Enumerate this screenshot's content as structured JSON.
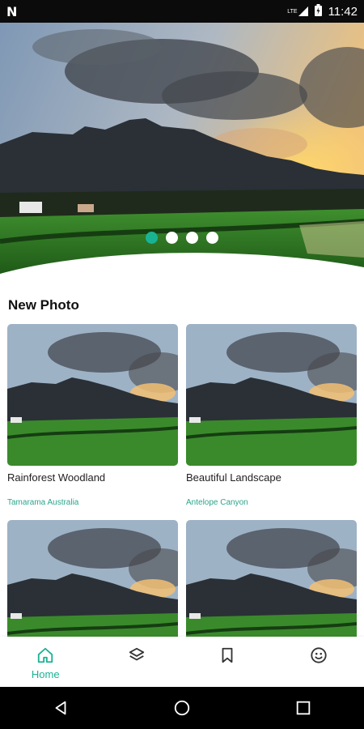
{
  "status": {
    "time": "11:42",
    "signal": "LTE"
  },
  "hero": {
    "slide_count": 4,
    "active_index": 0
  },
  "section": {
    "title": "New Photo"
  },
  "photos": [
    {
      "title": "Rainforest Woodland",
      "location": "Tamarama Australia"
    },
    {
      "title": "Beautiful Landscape",
      "location": "Antelope Canyon"
    },
    {
      "title": "",
      "location": ""
    },
    {
      "title": "",
      "location": ""
    }
  ],
  "nav": {
    "home_label": "Home",
    "items": [
      "home-icon",
      "layers-icon",
      "bookmark-icon",
      "smiley-icon"
    ],
    "active_color": "#19b394"
  },
  "system_nav": [
    "back-icon",
    "home-circle-icon",
    "recents-icon"
  ]
}
